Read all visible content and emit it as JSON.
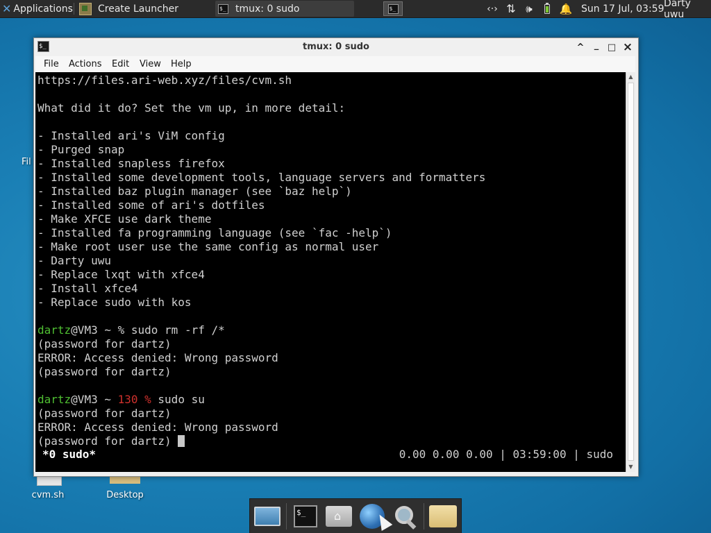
{
  "top_panel": {
    "applications_label": "Applications",
    "tasks": [
      {
        "label": "Create Launcher"
      },
      {
        "label": "tmux: 0 sudo"
      }
    ],
    "clock": "Sun 17 Jul, 03:59",
    "user": "Darty uwu",
    "icons": [
      "xfce-menu-icon",
      "launcher-icon",
      "terminal-icon",
      "workspace-pager",
      "network-icon",
      "transfer-icon",
      "volume-icon",
      "battery-icon",
      "notification-bell-icon"
    ]
  },
  "desktop": {
    "partial_label_left": "Fil",
    "icons": [
      {
        "label": "cvm.sh"
      },
      {
        "label": "Desktop"
      }
    ]
  },
  "window": {
    "title": "tmux: 0 sudo",
    "menu": [
      "File",
      "Actions",
      "Edit",
      "View",
      "Help"
    ],
    "controls": {
      "shade": "^",
      "minimize": "_",
      "maximize": "□",
      "close": "×"
    }
  },
  "terminal": {
    "lines": [
      "https://files.ari-web.xyz/files/cvm.sh",
      "",
      "What did it do? Set the vm up, in more detail:",
      "",
      "- Installed ari's ViM config",
      "- Purged snap",
      "- Installed snapless firefox",
      "- Installed some development tools, language servers and formatters",
      "- Installed baz plugin manager (see `baz help`)",
      "- Installed some of ari's dotfiles",
      "- Make XFCE use dark theme",
      "- Installed fa programming language (see `fac -help`)",
      "- Make root user use the same config as normal user",
      "- Darty uwu",
      "- Replace lxqt with xfce4",
      "- Install xfce4",
      "- Replace sudo with kos"
    ],
    "prompt1": {
      "user": "dartz",
      "host": "@VM3 ~ % ",
      "command": "sudo rm -rf /*"
    },
    "output1": [
      "(password for dartz)",
      "ERROR: Access denied: Wrong password",
      "(password for dartz)"
    ],
    "prompt2": {
      "user": "dartz",
      "host": "@VM3 ~ ",
      "code": "130 %",
      "command": " sudo su"
    },
    "output2": [
      "(password for dartz)",
      "ERROR: Access denied: Wrong password"
    ],
    "last_line": "(password for dartz) ",
    "status_left": "*0 sudo*",
    "status_right": "0.00 0.00 0.00 | 03:59:00 | sudo"
  },
  "dock": {
    "items": [
      "show-desktop-icon",
      "terminal-icon",
      "home-folder-icon",
      "web-browser-icon",
      "app-finder-icon",
      "file-manager-icon"
    ]
  },
  "colors": {
    "panel": "#2b2b2b",
    "desktop": "#1a7fb5",
    "terminal_bg": "#000000",
    "prompt_green": "#4fbf32",
    "error_red": "#d0312d"
  }
}
